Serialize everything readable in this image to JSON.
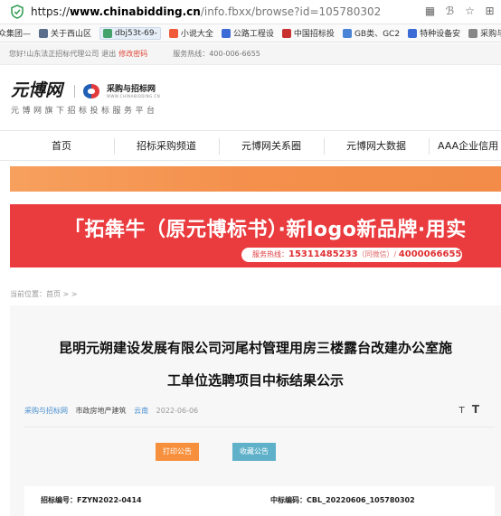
{
  "browser": {
    "url_prefix": "https://",
    "url_host": "www.chinabidding.cn",
    "url_path": "/info.fbxx/browse?id=105780302",
    "icons": [
      "grid-icon",
      "reader-icon",
      "favorite-icon",
      "extensions-icon"
    ]
  },
  "bookmarks": [
    {
      "label": "众集团—",
      "color": "#e8e8e8"
    },
    {
      "label": "关于西山区",
      "color": "#5a6e8c"
    },
    {
      "label": "dbj53t-69-",
      "color": "#44a36b"
    },
    {
      "label": "小说大全",
      "color": "#f05a3a"
    },
    {
      "label": "公路工程设",
      "color": "#3d6bd6"
    },
    {
      "label": "中国招标投",
      "color": "#c8312f"
    },
    {
      "label": "GB类、GC2",
      "color": "#4b83d6"
    },
    {
      "label": "特种设备安",
      "color": "#3d6bd6"
    },
    {
      "label": "采购与招标",
      "color": "#888888"
    }
  ],
  "infobar": {
    "welcome": "您好!山东法正招标代理公司",
    "logout": "退出",
    "change_password": "修改密码",
    "hotline": "服务热线：400-006-6655"
  },
  "header": {
    "logo1_text": "元博网",
    "logo2_title": "采购与招标网",
    "logo2_sub": "WWW.CHINABIDDING.CN",
    "slogan": "元博网旗下招标投标服务平台"
  },
  "nav": {
    "tabs": [
      "首页",
      "招标采购频道",
      "元博网关系圈",
      "元博网大数据",
      "AAA企业信用"
    ]
  },
  "banner": {
    "headline": "「拓犇牛（原元博标书）·新logo新品牌·用实",
    "hotline_label": "服务热线：",
    "hotline_number": "15311485233",
    "hotline_note": "（同微信）/",
    "hotline_number2": "4000066655"
  },
  "breadcrumb": "当前位置：首页 > >",
  "article": {
    "title_line1": "昆明元朔建设发展有限公司河尾村管理用房三楼露台改建办公室施",
    "title_line2": "工单位选聘项目中标结果公示",
    "source": "采购与招标网",
    "category": "市政房地产建筑",
    "region": "云南",
    "date": "2022-06-06",
    "font_small": "T",
    "font_large": "T",
    "print_button": "打印公告",
    "favorite_button": "收藏公告",
    "bid_number": "招标编号：FZYN2022-0414",
    "winner_code": "中标编码：CBL_20220606_105780302"
  },
  "colors": {
    "accent_red": "#ea3b3e",
    "orange": "#f48f4c",
    "print_btn": "#f7903d",
    "favorite_btn": "#5fb1c9",
    "link_blue": "#4a8fcf"
  }
}
